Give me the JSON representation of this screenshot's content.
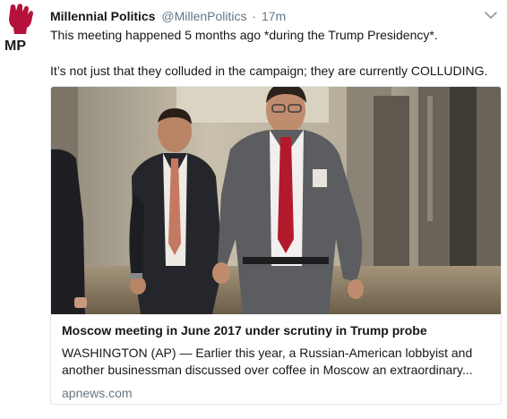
{
  "tweet": {
    "author_name": "Millennial Politics",
    "handle": "@MillenPolitics",
    "separator": "·",
    "time": "17m",
    "avatar_text": "MP",
    "text_lines": [
      "This meeting happened 5 months ago *during the Trump Presidency*.",
      "It’s not just that they colluded in the campaign; they are currently COLLUDING."
    ]
  },
  "card": {
    "title": "Moscow meeting in June 2017 under scrutiny in Trump probe",
    "description_lines": [
      "WASHINGTON (AP) — Earlier this year, a Russian-American lobbyist and",
      "another businessman discussed over coffee in Moscow an extraordinary..."
    ],
    "domain": "apnews.com",
    "image_icon": "news-photo"
  },
  "icons": {
    "caret": "chevron-down-icon",
    "avatar": "raised-fist-logo"
  },
  "colors": {
    "text": "#14171a",
    "secondary": "#657786",
    "border": "#e1e8ed",
    "avatar_red": "#b5123b"
  }
}
